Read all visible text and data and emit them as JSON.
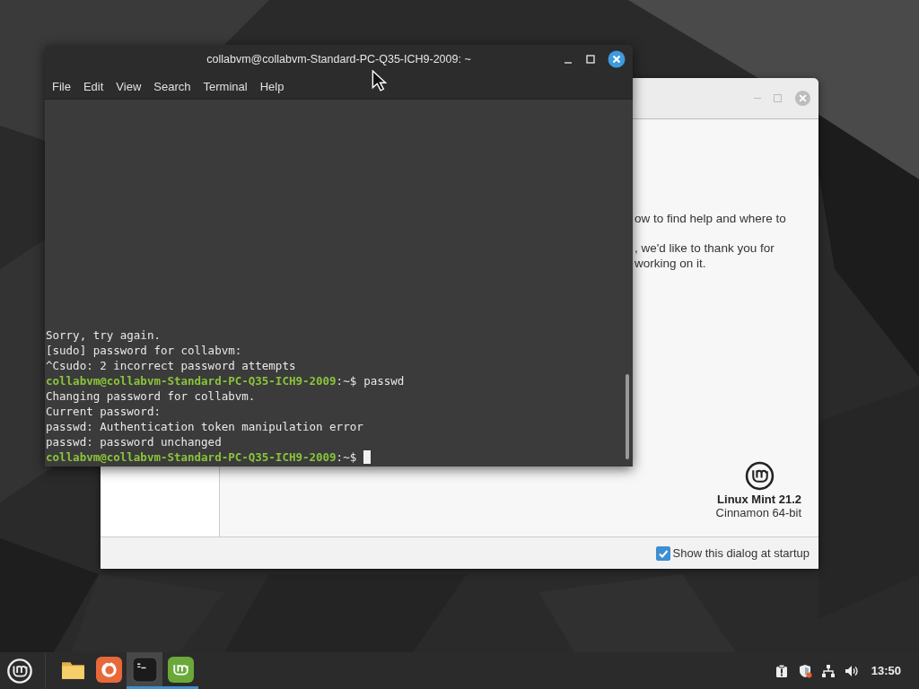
{
  "terminal_window": {
    "title": "collabvm@collabvm-Standard-PC-Q35-ICH9-2009: ~",
    "menu": [
      "File",
      "Edit",
      "View",
      "Search",
      "Terminal",
      "Help"
    ],
    "lines": [
      {
        "kind": "output",
        "text": "Sorry, try again."
      },
      {
        "kind": "output",
        "text": "[sudo] password for collabvm:"
      },
      {
        "kind": "output",
        "text": "^Csudo: 2 incorrect password attempts"
      },
      {
        "kind": "prompt",
        "user_host": "collabvm@collabvm-Standard-PC-Q35-ICH9-2009",
        "path": ":~$",
        "command": "passwd"
      },
      {
        "kind": "output",
        "text": "Changing password for collabvm."
      },
      {
        "kind": "output",
        "text": "Current password:"
      },
      {
        "kind": "output",
        "text": "passwd: Authentication token manipulation error"
      },
      {
        "kind": "output",
        "text": "passwd: password unchanged"
      },
      {
        "kind": "prompt",
        "user_host": "collabvm@collabvm-Standard-PC-Q35-ICH9-2009",
        "path": ":~$",
        "cursor": true
      }
    ]
  },
  "welcome_window": {
    "paragraphs": [
      [
        "ow to find help and where to"
      ],
      [
        ", we'd like to thank you for",
        "working on it."
      ]
    ],
    "product": "Linux Mint 21.2",
    "edition": "Cinnamon 64-bit",
    "startup_checkbox": {
      "label": "Show this dialog at startup",
      "checked": true
    }
  },
  "taskbar": {
    "apps": [
      {
        "kind": "folder",
        "running": false,
        "selected": false
      },
      {
        "kind": "browser",
        "running": false,
        "selected": false
      },
      {
        "kind": "terminal",
        "running": true,
        "selected": true
      },
      {
        "kind": "mint",
        "running": true,
        "selected": false
      }
    ],
    "clock": "13:50"
  }
}
